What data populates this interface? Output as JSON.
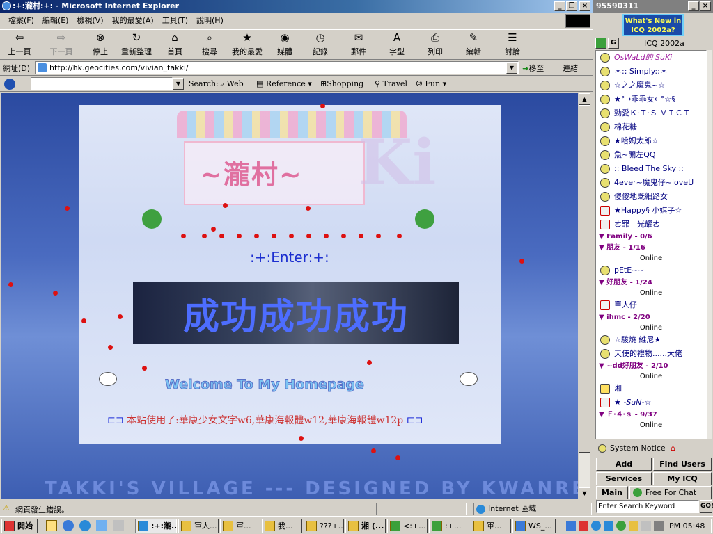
{
  "window": {
    "title": ":+:瀧村:+: - Microsoft Internet Explorer"
  },
  "menu": [
    "檔案(F)",
    "編輯(E)",
    "檢視(V)",
    "我的最愛(A)",
    "工具(T)",
    "說明(H)"
  ],
  "toolbar": [
    {
      "label": "上一頁",
      "icon": "back-arrow-icon"
    },
    {
      "label": "下一頁",
      "icon": "forward-arrow-icon"
    },
    {
      "label": "停止",
      "icon": "stop-icon"
    },
    {
      "label": "重新整理",
      "icon": "refresh-icon"
    },
    {
      "label": "首頁",
      "icon": "home-icon"
    },
    {
      "label": "搜尋",
      "icon": "search-icon"
    },
    {
      "label": "我的最愛",
      "icon": "favorites-icon"
    },
    {
      "label": "媒體",
      "icon": "media-icon"
    },
    {
      "label": "記錄",
      "icon": "history-icon"
    },
    {
      "label": "郵件",
      "icon": "mail-icon"
    },
    {
      "label": "字型",
      "icon": "font-icon"
    },
    {
      "label": "列印",
      "icon": "print-icon"
    },
    {
      "label": "編輯",
      "icon": "edit-icon"
    },
    {
      "label": "討論",
      "icon": "discuss-icon"
    }
  ],
  "address": {
    "label": "網址(D)",
    "url": "http://hk.geocities.com/vivian_takki/",
    "go": "移至",
    "links": "連結"
  },
  "searchbar": {
    "label": "Search:",
    "items": [
      "Web",
      "Reference",
      "Shopping",
      "Travel",
      "Fun"
    ]
  },
  "page": {
    "title": "~瀧村~",
    "enter": ":+:Enter:+:",
    "banner": "成功成功成功",
    "welcome": "Welcome To My Homepage",
    "fonts": "本站使用了:華康少女文字w6,華康海報體w12,華康海報體w12p",
    "footer": "TAKKI'S VILLAGE --- DESIGNED BY KWANREN"
  },
  "status": {
    "text": "網頁發生錯誤。",
    "zone": "Internet 區域"
  },
  "icq": {
    "uin": "95590311",
    "ad": "What's New in ICQ 2002a?",
    "header": "ICQ 2002a",
    "contacts": [
      "OsWaLd的 SuKi",
      "＊:: Simply::＊",
      "☆之之魔鬼~☆",
      "★°→乖乖女←°☆§",
      "勁愛Ｋ‧Ｔ‧Ｓ ＶＩＣＴ",
      "棉花糖",
      "★哈姆太郎☆",
      "魚~開左QQ",
      ":: Bleed The Sky ::",
      "4ever~魔鬼仔~loveU",
      "傻傻地既細路女",
      "★Happy§ 小娸子☆",
      "ㄜ罪　光耀ㄜ"
    ],
    "groups": [
      {
        "name": "Family - 0/6",
        "items": []
      },
      {
        "name": "朋友 - 1/16",
        "online": "Online",
        "items": [
          "pEtE~~"
        ]
      },
      {
        "name": "好朋友 - 1/24",
        "online": "Online",
        "items": [
          "單人仔"
        ]
      },
      {
        "name": "ihmc - 2/20",
        "online": "Online",
        "items": [
          "☆駿燒 維尼★",
          "天使的禮物......大佬"
        ]
      },
      {
        "name": "~dd好朋友 - 2/10",
        "online": "Online",
        "items": [
          "湘",
          "★ -SuN-☆"
        ]
      },
      {
        "name": "Ｆ‧４‧ｓ - 9/37",
        "online": "Online",
        "items": []
      }
    ],
    "system_notice": "System Notice",
    "buttons": [
      "Add",
      "Find Users",
      "Services",
      "My ICQ"
    ],
    "main": "Main",
    "free_for_chat": "Free For Chat",
    "search_placeholder": "Enter Search Keyword",
    "go": "GO!"
  },
  "taskbar": {
    "start": "開始",
    "tasks": [
      ":+:瀧...",
      "軍人...",
      "軍...",
      "我...",
      "???+...",
      "湘 (...",
      "<:+...",
      ":+...",
      "軍...",
      "WS_..."
    ],
    "clock": "PM 05:48"
  }
}
